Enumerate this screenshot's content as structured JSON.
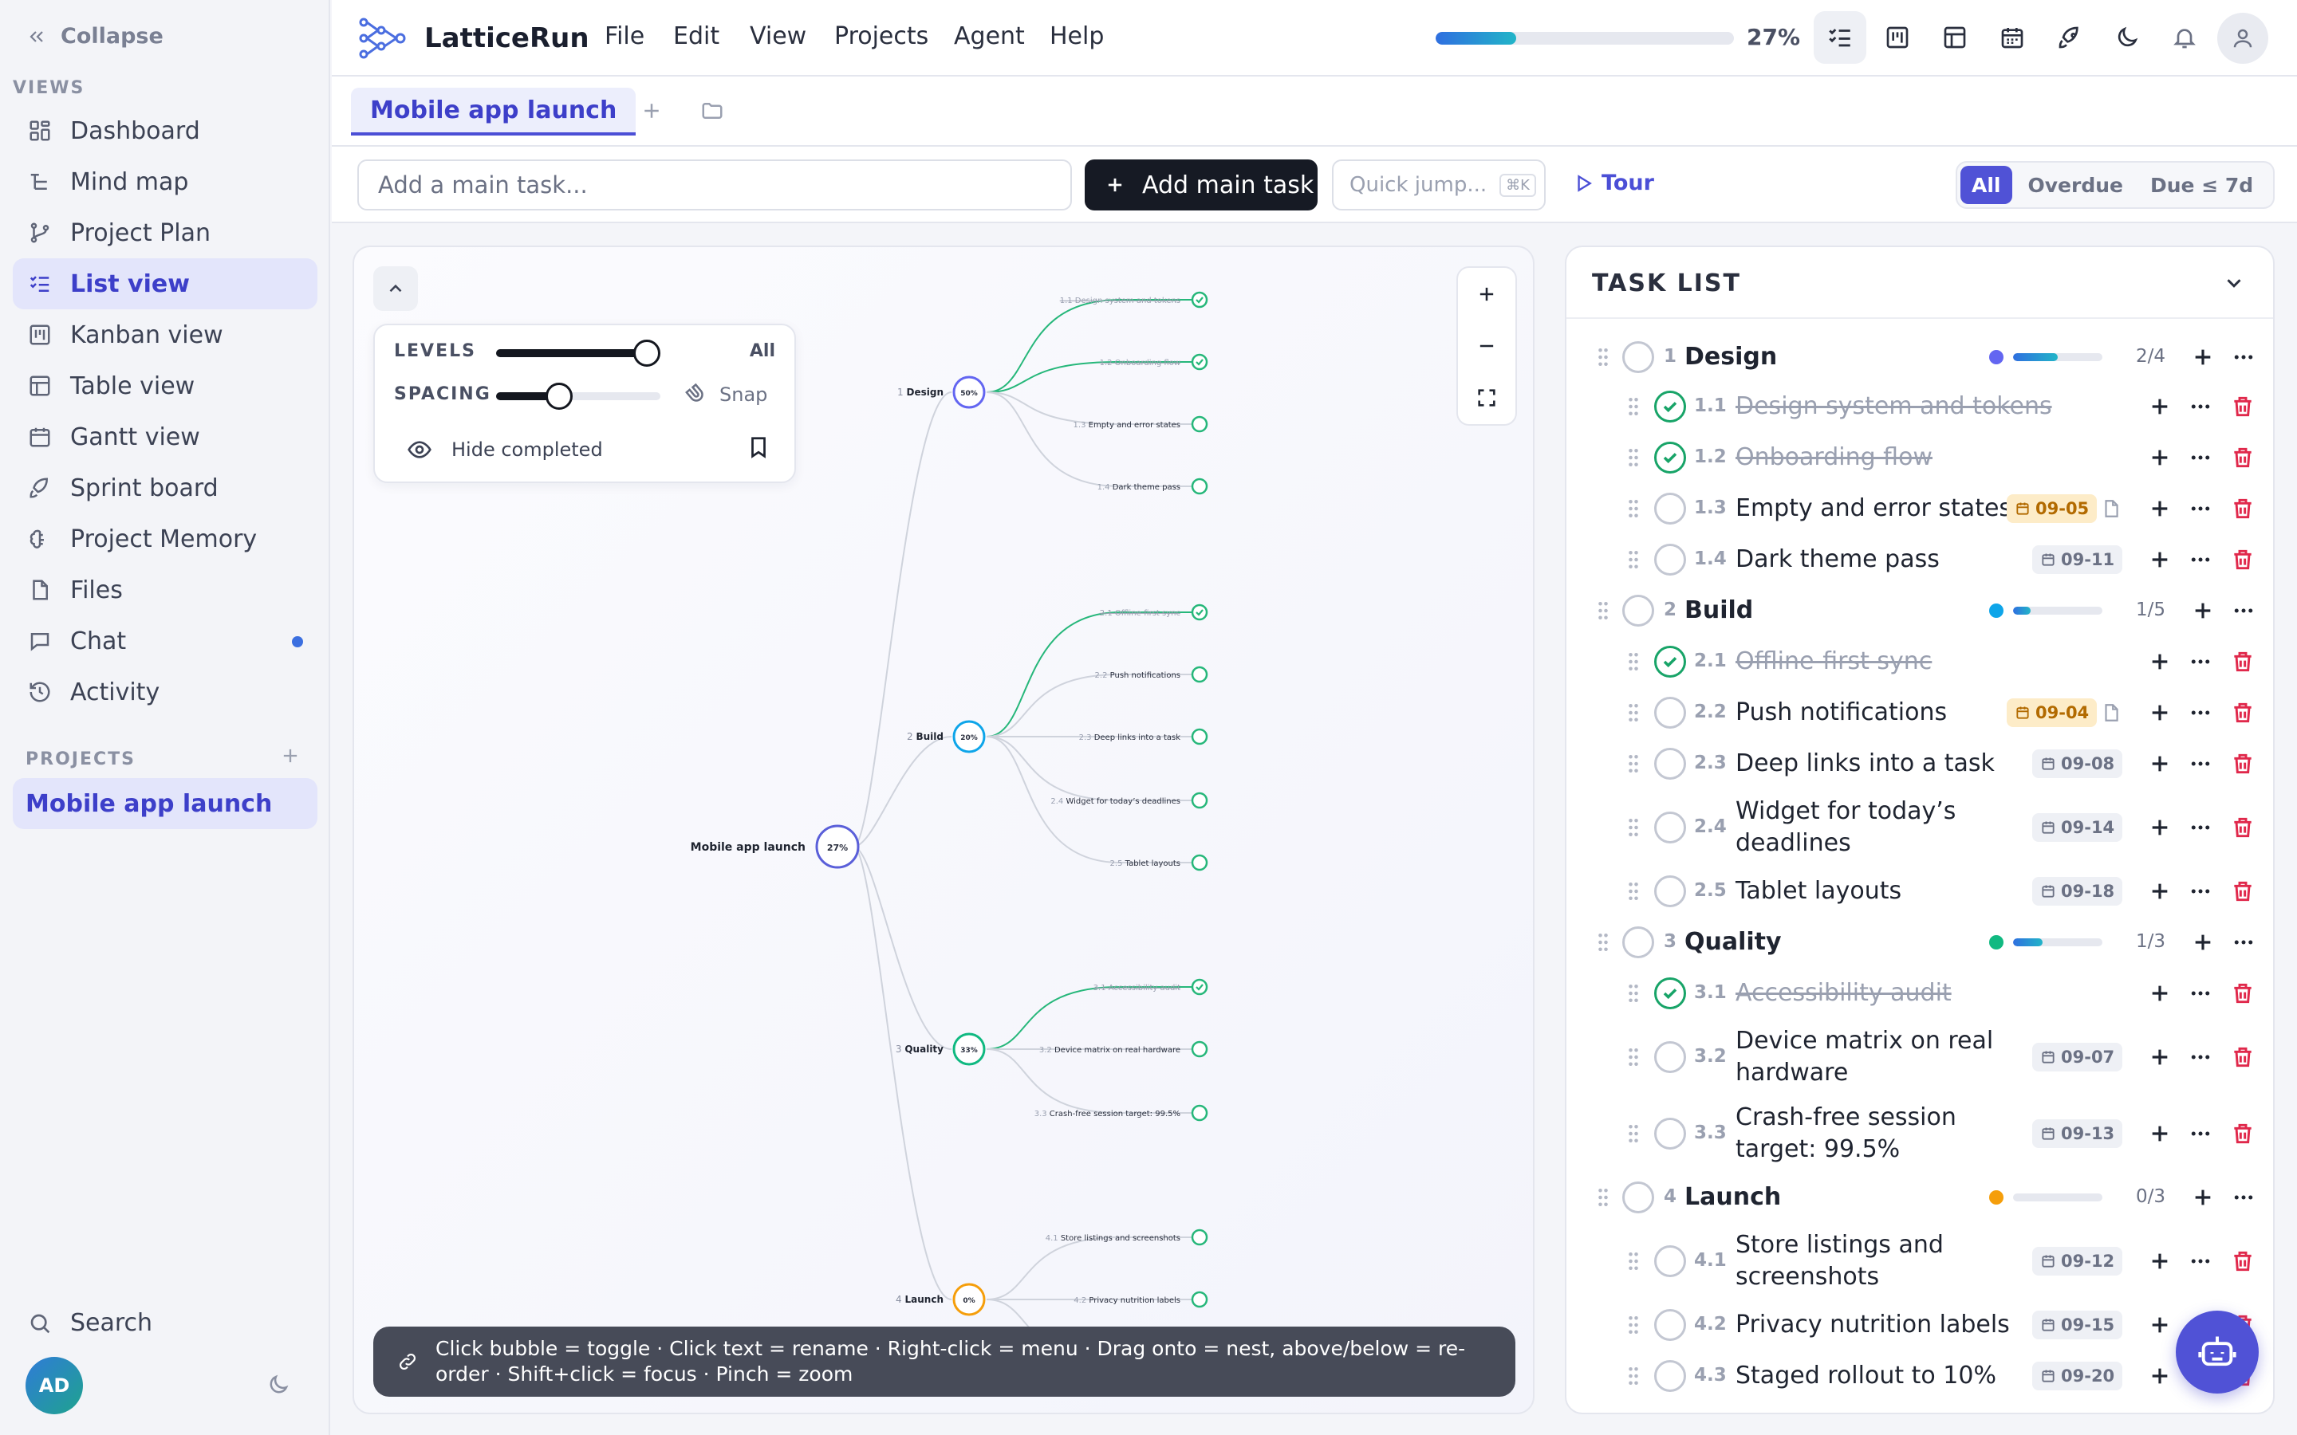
{
  "sidebar": {
    "collapse_label": "Collapse",
    "views_label": "VIEWS",
    "items": [
      {
        "label": "Dashboard",
        "icon": "grid-icon"
      },
      {
        "label": "Mind map",
        "icon": "tree-icon"
      },
      {
        "label": "Project Plan",
        "icon": "branch-icon"
      },
      {
        "label": "List view",
        "icon": "list-check-icon",
        "active": true
      },
      {
        "label": "Kanban view",
        "icon": "kanban-icon"
      },
      {
        "label": "Table view",
        "icon": "table-icon"
      },
      {
        "label": "Gantt view",
        "icon": "calendar-icon"
      },
      {
        "label": "Sprint board",
        "icon": "rocket-icon"
      },
      {
        "label": "Project Memory",
        "icon": "brain-icon"
      },
      {
        "label": "Files",
        "icon": "file-icon"
      },
      {
        "label": "Chat",
        "icon": "chat-icon",
        "badge": true
      },
      {
        "label": "Activity",
        "icon": "history-icon"
      }
    ],
    "projects_label": "PROJECTS",
    "project": "Mobile app launch",
    "search_label": "Search",
    "avatar_initials": "AD"
  },
  "header": {
    "app_name": "LatticeRun",
    "menu": [
      "File",
      "Edit",
      "View",
      "Projects",
      "Agent",
      "Help"
    ],
    "progress_pct": 27,
    "progress_label": "27%"
  },
  "tabs": {
    "active": "Mobile app launch"
  },
  "toolbar": {
    "input_placeholder": "Add a main task...",
    "add_label": "Add main task",
    "quick_jump": "Quick jump...",
    "quick_jump_kbd": "⌘K",
    "tour_label": "Tour",
    "filters": [
      "All",
      "Overdue",
      "Due ≤ 7d"
    ]
  },
  "map": {
    "levels_label": "LEVELS",
    "levels_value": "All",
    "spacing_label": "SPACING",
    "snap_label": "Snap",
    "hide_completed": "Hide completed",
    "root": {
      "label": "Mobile app launch",
      "pct": "27%"
    },
    "hint": "Click bubble = toggle · Click text = rename · Right-click = menu · Drag onto = nest, above/below = re-order · Shift+click = focus · Pinch = zoom"
  },
  "tasklist": {
    "title": "TASK LIST",
    "groups": [
      {
        "num": "1",
        "title": "Design",
        "color": "#6366f1",
        "progress": 0.5,
        "count": "2/4",
        "pct": "50%",
        "tasks": [
          {
            "num": "1.1",
            "title": "Design system and tokens",
            "done": true
          },
          {
            "num": "1.2",
            "title": "Onboarding flow",
            "done": true
          },
          {
            "num": "1.3",
            "title": "Empty and error states",
            "due": "09-05",
            "warn": true,
            "note": true
          },
          {
            "num": "1.4",
            "title": "Dark theme pass",
            "due": "09-11"
          }
        ]
      },
      {
        "num": "2",
        "title": "Build",
        "color": "#0ea5e9",
        "progress": 0.2,
        "count": "1/5",
        "pct": "20%",
        "tasks": [
          {
            "num": "2.1",
            "title": "Offline-first sync",
            "done": true
          },
          {
            "num": "2.2",
            "title": "Push notifications",
            "due": "09-04",
            "warn": true,
            "note": true
          },
          {
            "num": "2.3",
            "title": "Deep links into a task",
            "due": "09-08"
          },
          {
            "num": "2.4",
            "title": "Widget for today’s deadlines",
            "due": "09-14"
          },
          {
            "num": "2.5",
            "title": "Tablet layouts",
            "due": "09-18"
          }
        ]
      },
      {
        "num": "3",
        "title": "Quality",
        "color": "#10b981",
        "progress": 0.33,
        "count": "1/3",
        "pct": "33%",
        "tasks": [
          {
            "num": "3.1",
            "title": "Accessibility audit",
            "done": true
          },
          {
            "num": "3.2",
            "title": "Device matrix on real hardware",
            "due": "09-07"
          },
          {
            "num": "3.3",
            "title": "Crash-free session target: 99.5%",
            "due": "09-13"
          }
        ]
      },
      {
        "num": "4",
        "title": "Launch",
        "color": "#f59e0b",
        "progress": 0,
        "count": "0/3",
        "pct": "0%",
        "tasks": [
          {
            "num": "4.1",
            "title": "Store listings and screenshots",
            "due": "09-12"
          },
          {
            "num": "4.2",
            "title": "Privacy nutrition labels",
            "due": "09-15"
          },
          {
            "num": "4.3",
            "title": "Staged rollout to 10%",
            "due": "09-20"
          }
        ]
      }
    ]
  }
}
